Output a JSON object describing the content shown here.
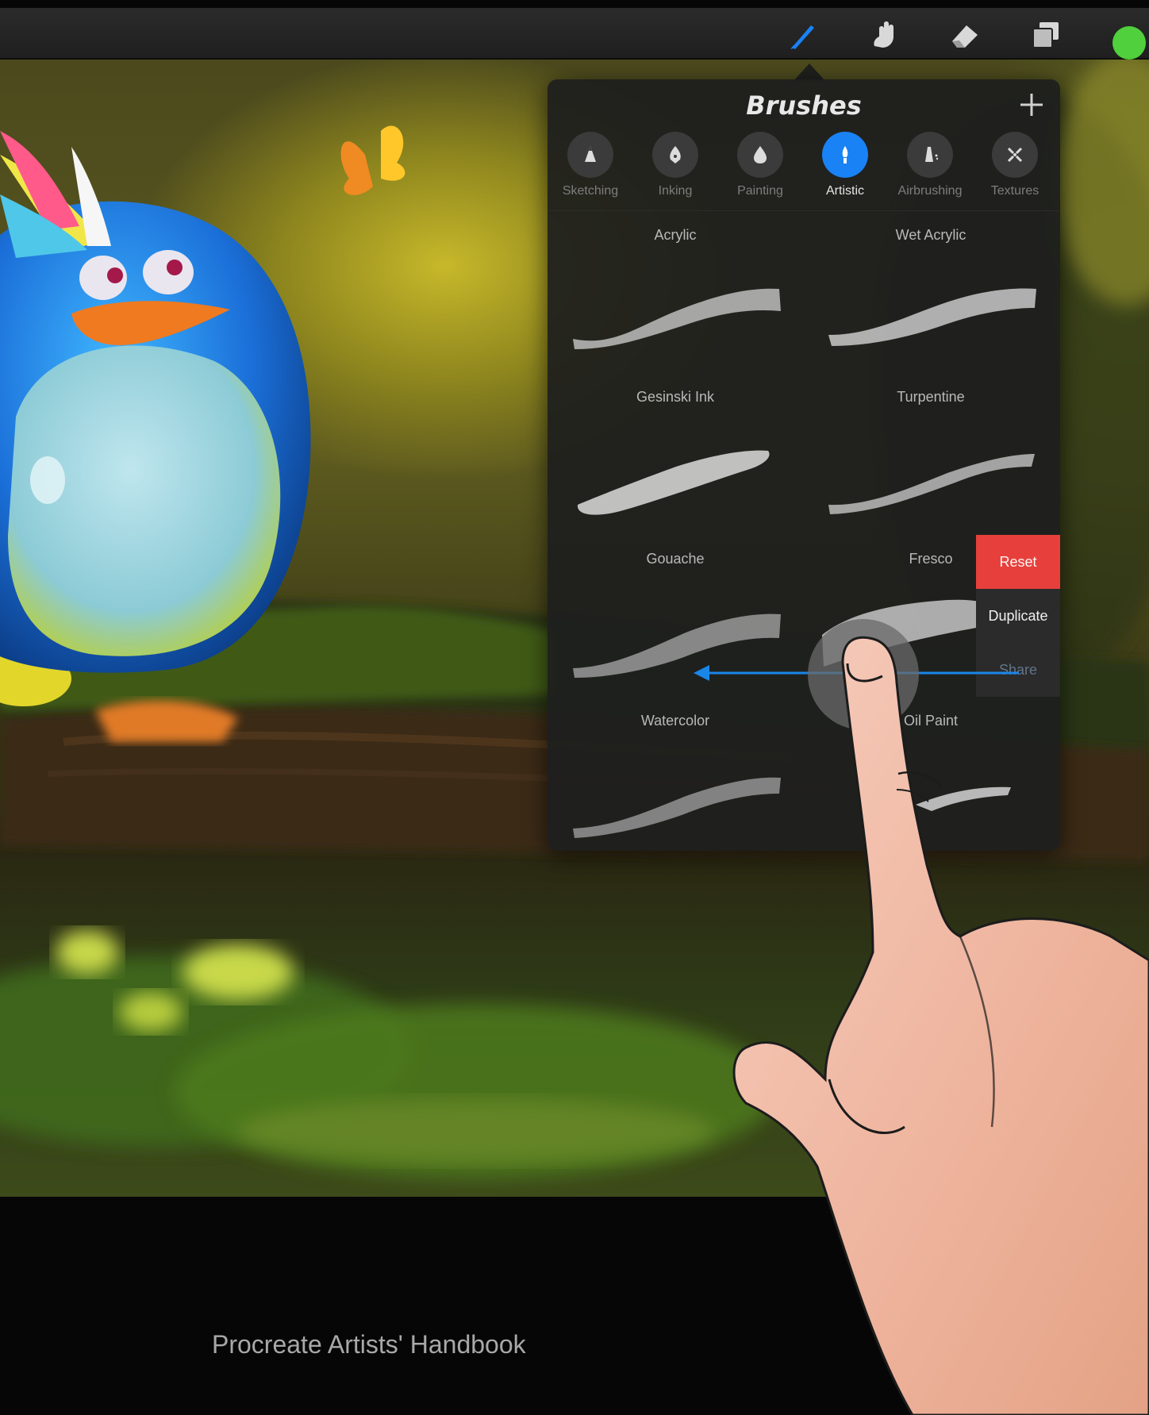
{
  "toolbar": {
    "tools": [
      {
        "name": "brush",
        "icon": "brush-icon",
        "active": true
      },
      {
        "name": "smudge",
        "icon": "smudge-icon",
        "active": false
      },
      {
        "name": "eraser",
        "icon": "eraser-icon",
        "active": false
      },
      {
        "name": "layers",
        "icon": "layers-icon",
        "active": false
      }
    ],
    "color": "#4fd03c",
    "active_color": "#1982f5",
    "inactive_color": "#d8d8d8"
  },
  "brushes_panel": {
    "title": "Brushes",
    "categories": [
      {
        "label": "Sketching",
        "icon": "pencil-nib-icon",
        "active": false
      },
      {
        "label": "Inking",
        "icon": "ink-pen-icon",
        "active": false
      },
      {
        "label": "Painting",
        "icon": "paint-drop-icon",
        "active": false
      },
      {
        "label": "Artistic",
        "icon": "artistic-brush-icon",
        "active": true
      },
      {
        "label": "Airbrushing",
        "icon": "airbrush-icon",
        "active": false
      },
      {
        "label": "Textures",
        "icon": "texture-icon",
        "active": false
      }
    ],
    "brushes": [
      {
        "name": "Acrylic"
      },
      {
        "name": "Wet Acrylic"
      },
      {
        "name": "Gesinski Ink"
      },
      {
        "name": "Turpentine"
      },
      {
        "name": "Gouache"
      },
      {
        "name": "Fresco"
      },
      {
        "name": "Watercolor"
      },
      {
        "name": "Oil Paint"
      }
    ],
    "swipe_actions": {
      "reset": "Reset",
      "duplicate": "Duplicate",
      "share": "Share"
    },
    "reset_color": "#e7403c"
  },
  "caption": "Procreate Artists' Handbook"
}
